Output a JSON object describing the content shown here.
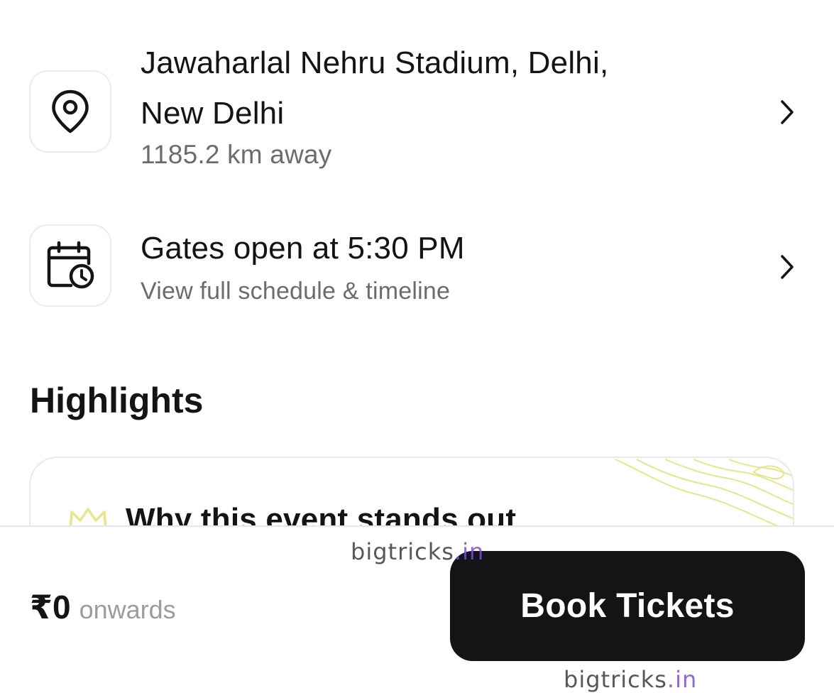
{
  "venue": {
    "title_line1": "Jawaharlal Nehru Stadium, Delhi,",
    "title_line2": "New Delhi",
    "distance": "1185.2 km away",
    "icon": "location-pin-icon"
  },
  "schedule": {
    "title": "Gates open at 5:30 PM",
    "subtitle": "View full schedule & timeline",
    "icon": "calendar-clock-icon"
  },
  "highlights": {
    "section_title": "Highlights",
    "card_heading": "Why this event stands out",
    "card_icon": "crown-icon"
  },
  "footer": {
    "price": "₹0",
    "price_suffix": "onwards",
    "book_button": "Book Tickets"
  },
  "watermark": {
    "name": "bigtricks",
    "tld": ".in"
  },
  "colors": {
    "primary_text": "#141414",
    "secondary_text": "#6c6c6c",
    "button_bg": "#141416",
    "accent_pattern": "#e3e88a"
  }
}
